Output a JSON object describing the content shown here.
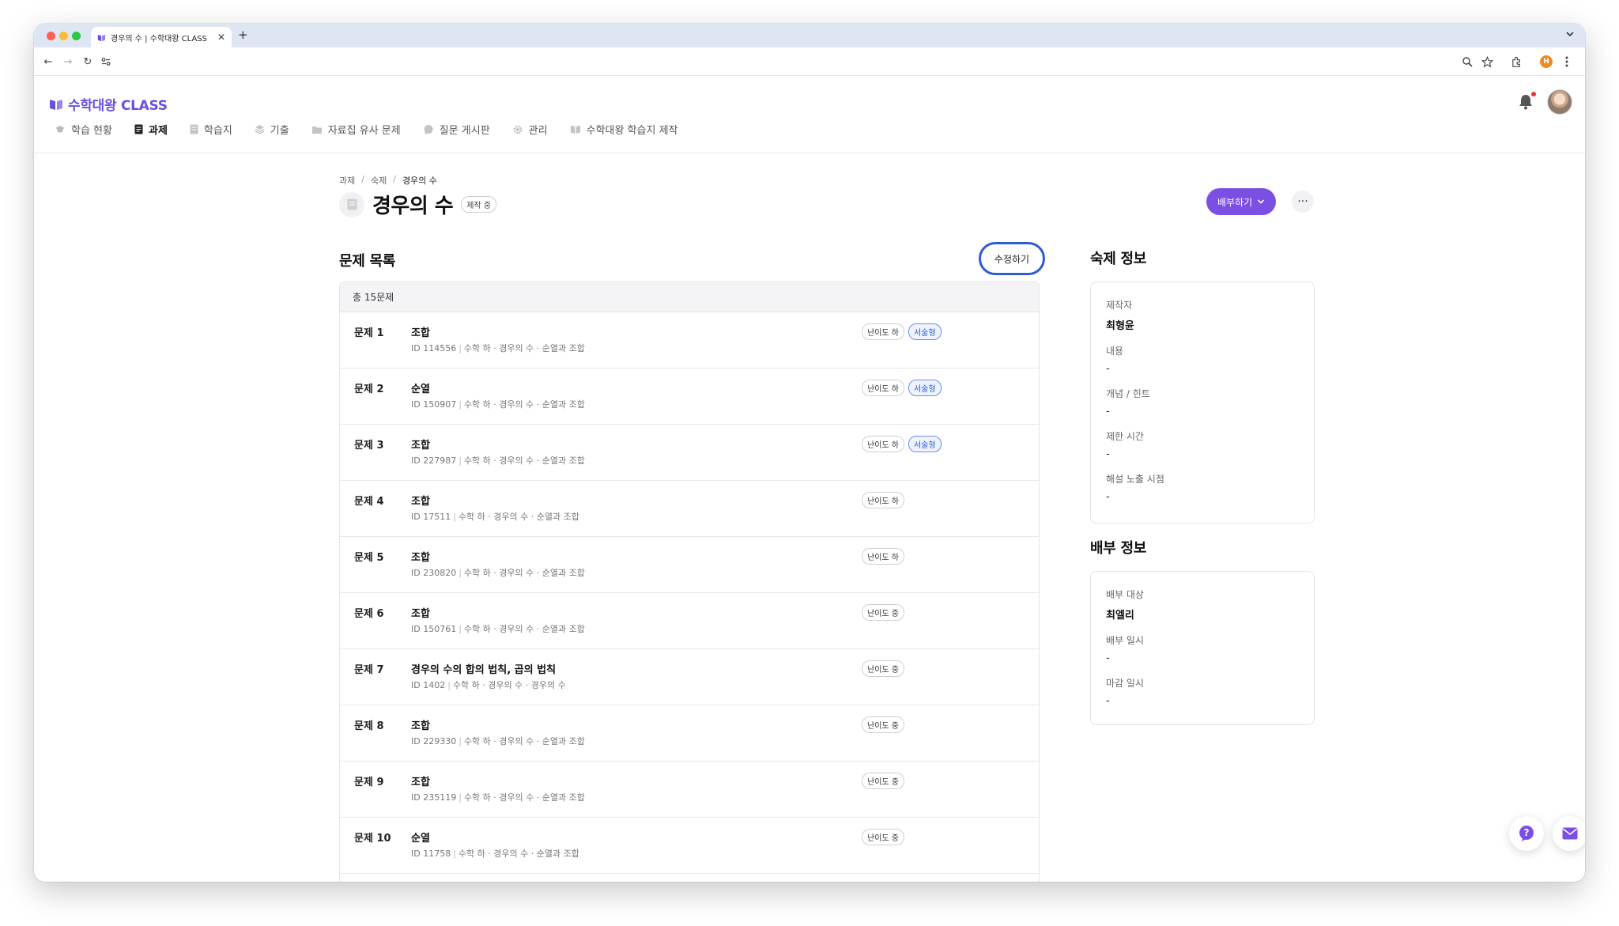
{
  "browser": {
    "tab_title": "경우의 수 | 수학대왕 CLASS",
    "profile_initial": "H"
  },
  "app": {
    "logo": "수학대왕 CLASS",
    "nav": [
      {
        "label": "학습 현황",
        "icon": "graduation-cap-icon"
      },
      {
        "label": "과제",
        "icon": "document-icon"
      },
      {
        "label": "학습지",
        "icon": "worksheet-icon"
      },
      {
        "label": "기출",
        "icon": "layers-icon"
      },
      {
        "label": "자료집 유사 문제",
        "icon": "folder-icon"
      },
      {
        "label": "질문 게시판",
        "icon": "chat-icon"
      },
      {
        "label": "관리",
        "icon": "gear-icon"
      },
      {
        "label": "수학대왕 학습지 제작",
        "icon": "book-icon"
      }
    ]
  },
  "breadcrumb": [
    "과제",
    "숙제",
    "경우의 수"
  ],
  "page": {
    "title": "경우의 수",
    "status": "제작 중",
    "distribute_label": "배부하기",
    "more_label": "···"
  },
  "problems": {
    "section_title": "문제 목록",
    "edit_label": "수정하기",
    "total": "총 15문제",
    "rows": [
      {
        "num": "문제 1",
        "name": "조합",
        "id": "ID 114556",
        "path": "수학 하 · 경우의 수 · 순열과 조합",
        "difficulty": "난이도 하",
        "type": "서술형"
      },
      {
        "num": "문제 2",
        "name": "순열",
        "id": "ID 150907",
        "path": "수학 하 · 경우의 수 · 순열과 조합",
        "difficulty": "난이도 하",
        "type": "서술형"
      },
      {
        "num": "문제 3",
        "name": "조합",
        "id": "ID 227987",
        "path": "수학 하 · 경우의 수 · 순열과 조합",
        "difficulty": "난이도 하",
        "type": "서술형"
      },
      {
        "num": "문제 4",
        "name": "조합",
        "id": "ID 17511",
        "path": "수학 하 · 경우의 수 · 순열과 조합",
        "difficulty": "난이도 하",
        "type": ""
      },
      {
        "num": "문제 5",
        "name": "조합",
        "id": "ID 230820",
        "path": "수학 하 · 경우의 수 · 순열과 조합",
        "difficulty": "난이도 하",
        "type": ""
      },
      {
        "num": "문제 6",
        "name": "조합",
        "id": "ID 150761",
        "path": "수학 하 · 경우의 수 · 순열과 조합",
        "difficulty": "난이도 중",
        "type": ""
      },
      {
        "num": "문제 7",
        "name": "경우의 수의 합의 법칙, 곱의 법칙",
        "id": "ID 1402",
        "path": "수학 하 · 경우의 수 · 경우의 수",
        "difficulty": "난이도 중",
        "type": ""
      },
      {
        "num": "문제 8",
        "name": "조합",
        "id": "ID 229330",
        "path": "수학 하 · 경우의 수 · 순열과 조합",
        "difficulty": "난이도 중",
        "type": ""
      },
      {
        "num": "문제 9",
        "name": "조합",
        "id": "ID 235119",
        "path": "수학 하 · 경우의 수 · 순열과 조합",
        "difficulty": "난이도 중",
        "type": ""
      },
      {
        "num": "문제 10",
        "name": "순열",
        "id": "ID 11758",
        "path": "수학 하 · 경우의 수 · 순열과 조합",
        "difficulty": "난이도 중",
        "type": ""
      }
    ]
  },
  "homework_info": {
    "section_title": "숙제 정보",
    "items": [
      {
        "label": "제작자",
        "value": "최형윤"
      },
      {
        "label": "내용",
        "value": "-"
      },
      {
        "label": "개념 / 힌트",
        "value": "-"
      },
      {
        "label": "제한 시간",
        "value": "-"
      },
      {
        "label": "해설 노출 시점",
        "value": "-"
      }
    ]
  },
  "distribution_info": {
    "section_title": "배부 정보",
    "items": [
      {
        "label": "배부 대상",
        "value": "최엘리"
      },
      {
        "label": "배부 일시",
        "value": "-"
      },
      {
        "label": "마감 일시",
        "value": "-"
      }
    ]
  },
  "colors": {
    "accent": "#7b4fe3",
    "logo": "#6c4ee0",
    "tag_blue": "#2e5bd6"
  }
}
